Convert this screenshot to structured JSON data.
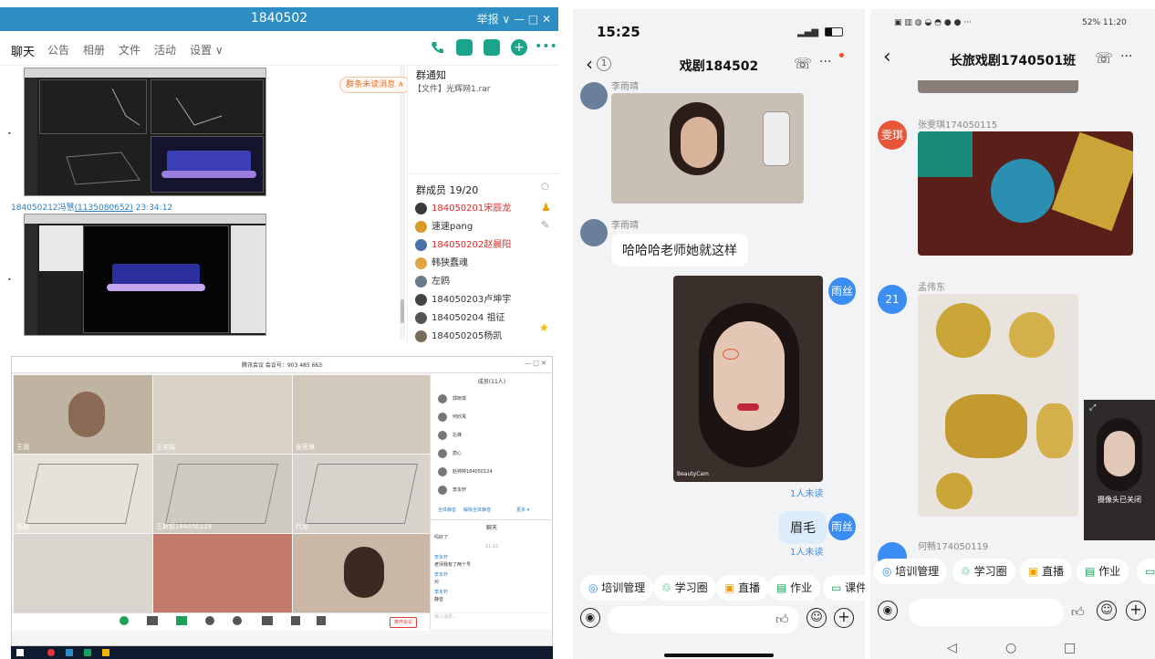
{
  "qq": {
    "title": "1840502",
    "window_controls": "举报 ∨  —  □  ✕",
    "tabs": [
      "聊天",
      "公告",
      "相册",
      "文件",
      "活动",
      "设置 ∨"
    ],
    "unread_bubble": "群条未读消息 ∧",
    "sender_name": "184050212冯慧",
    "sender_id": "(1135080652)",
    "sender_time": "23:34:12",
    "notice_title": "群通知",
    "notice_file": "【文件】光辉网1.rar",
    "members_title": "群成员 19/20",
    "members": [
      {
        "name": "184050201宋辰龙",
        "red": true,
        "color": "#3a3a3a"
      },
      {
        "name": "速速pang",
        "red": false,
        "color": "#d89b2a"
      },
      {
        "name": "184050202赵晨阳",
        "red": true,
        "color": "#4b6fa8"
      },
      {
        "name": "韩狭蠢魂",
        "red": false,
        "color": "#e0a640"
      },
      {
        "name": "左鸥",
        "red": false,
        "color": "#6b7a8a"
      },
      {
        "name": "184050203卢坤宇",
        "red": false,
        "color": "#444"
      },
      {
        "name": "184050204 祖征",
        "red": false,
        "color": "#555"
      },
      {
        "name": "184050205杨凯",
        "red": false,
        "color": "#7a6a5a"
      }
    ]
  },
  "meeting": {
    "title": "腾讯会议 会议号：903 485 663",
    "members_header": "成员(11人)",
    "tile_names": [
      "王钢",
      "王安娟",
      "张莹琳",
      "张楠",
      "王新韶184050129",
      "代龙",
      "",
      "",
      ""
    ],
    "side_members": [
      "郭晓琪",
      "何欣禹",
      "左峰",
      "唐心",
      "赵婷婷184050124",
      "李永轩"
    ],
    "chat_header": "聊天",
    "chat_lines": [
      {
        "who": "",
        "text": "吗好了"
      },
      {
        "who": "",
        "text": "11:10"
      },
      {
        "who": "李永轩",
        "text": "老师我有了两个号"
      },
      {
        "who": "李永轩",
        "text": "对"
      },
      {
        "who": "李永轩",
        "text": "静音"
      }
    ],
    "end_button": "离开会议"
  },
  "phone1": {
    "time": "15:25",
    "back_badge": "1",
    "title": "戏剧184502",
    "sender1": "李雨晴",
    "sender2": "李雨晴",
    "message2": "哈哈哈老师她就这样",
    "self_avatar": "雨丝",
    "photo_watermark": "BeautyCam",
    "unread": "1人未读",
    "message3": "眉毛",
    "self_avatar2": "雨丝",
    "unread2": "1人未读",
    "chips": [
      "培训管理",
      "学习圈",
      "直播",
      "作业",
      "课件"
    ]
  },
  "phone2": {
    "status_right": "52% 11:20",
    "title": "长旅戏剧1740501班",
    "sender1": "张雯琪174050115",
    "avatar1": "雯琪",
    "sender2": "孟伟东",
    "avatar2": "21",
    "sender3": "何畅174050119",
    "pip_text": "摄像头已关闭",
    "chips": [
      "培训管理",
      "学习圈",
      "直播",
      "作业"
    ]
  }
}
